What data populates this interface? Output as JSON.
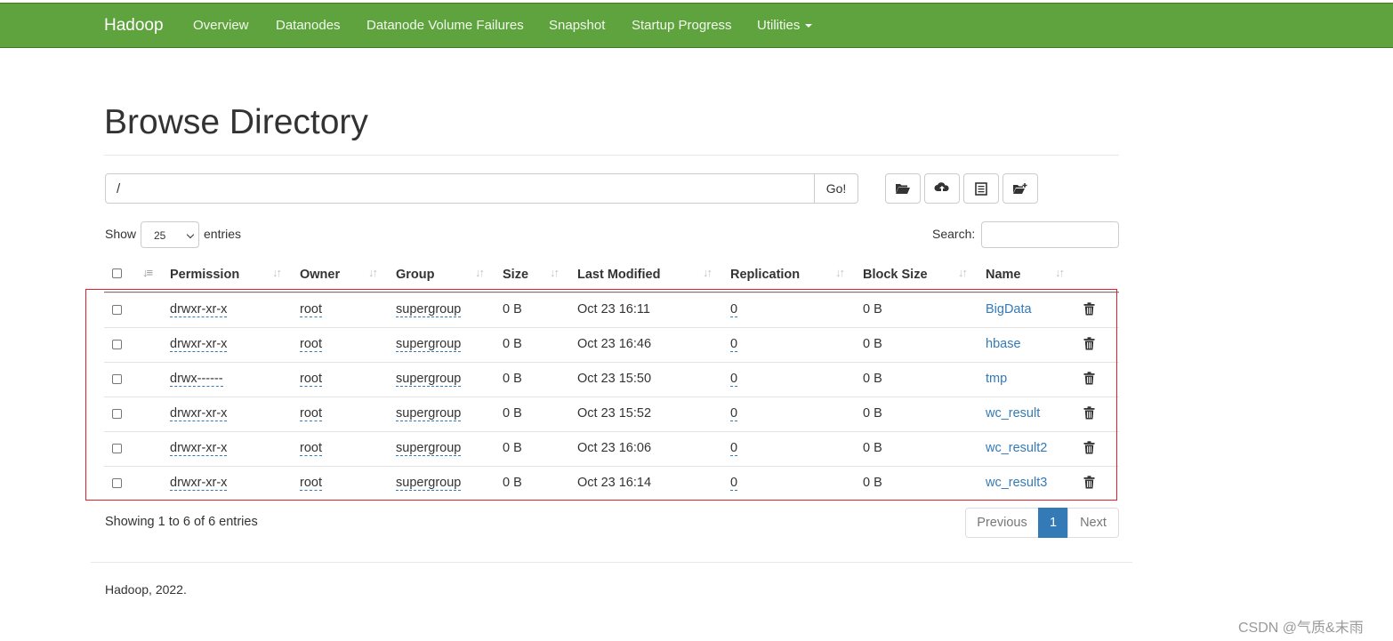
{
  "nav": {
    "brand": "Hadoop",
    "items": [
      "Overview",
      "Datanodes",
      "Datanode Volume Failures",
      "Snapshot",
      "Startup Progress",
      "Utilities"
    ]
  },
  "page": {
    "title": "Browse Directory"
  },
  "path": {
    "value": "/",
    "go_label": "Go!"
  },
  "toolbar": {
    "icons": [
      "folder-open-icon",
      "cloud-upload-icon",
      "list-alt-icon",
      "folder-new-icon"
    ]
  },
  "controls": {
    "show_label": "Show",
    "entries_value": "25",
    "entries_label": "entries",
    "search_label": "Search:"
  },
  "table": {
    "columns": [
      "Permission",
      "Owner",
      "Group",
      "Size",
      "Last Modified",
      "Replication",
      "Block Size",
      "Name"
    ],
    "rows": [
      {
        "permission": "drwxr-xr-x",
        "owner": "root",
        "group": "supergroup",
        "size": "0 B",
        "modified": "Oct 23 16:11",
        "replication": "0",
        "block_size": "0 B",
        "name": "BigData"
      },
      {
        "permission": "drwxr-xr-x",
        "owner": "root",
        "group": "supergroup",
        "size": "0 B",
        "modified": "Oct 23 16:46",
        "replication": "0",
        "block_size": "0 B",
        "name": "hbase"
      },
      {
        "permission": "drwx------",
        "owner": "root",
        "group": "supergroup",
        "size": "0 B",
        "modified": "Oct 23 15:50",
        "replication": "0",
        "block_size": "0 B",
        "name": "tmp"
      },
      {
        "permission": "drwxr-xr-x",
        "owner": "root",
        "group": "supergroup",
        "size": "0 B",
        "modified": "Oct 23 15:52",
        "replication": "0",
        "block_size": "0 B",
        "name": "wc_result"
      },
      {
        "permission": "drwxr-xr-x",
        "owner": "root",
        "group": "supergroup",
        "size": "0 B",
        "modified": "Oct 23 16:06",
        "replication": "0",
        "block_size": "0 B",
        "name": "wc_result2"
      },
      {
        "permission": "drwxr-xr-x",
        "owner": "root",
        "group": "supergroup",
        "size": "0 B",
        "modified": "Oct 23 16:14",
        "replication": "0",
        "block_size": "0 B",
        "name": "wc_result3"
      }
    ]
  },
  "info": {
    "showing": "Showing 1 to 6 of 6 entries"
  },
  "pagination": {
    "previous": "Previous",
    "current": "1",
    "next": "Next"
  },
  "footer": {
    "text": "Hadoop, 2022."
  },
  "watermark": "CSDN @气质&末雨",
  "colors": {
    "navbar": "#5fa33e",
    "link": "#337ab7",
    "highlight_box": "#e0202a"
  }
}
